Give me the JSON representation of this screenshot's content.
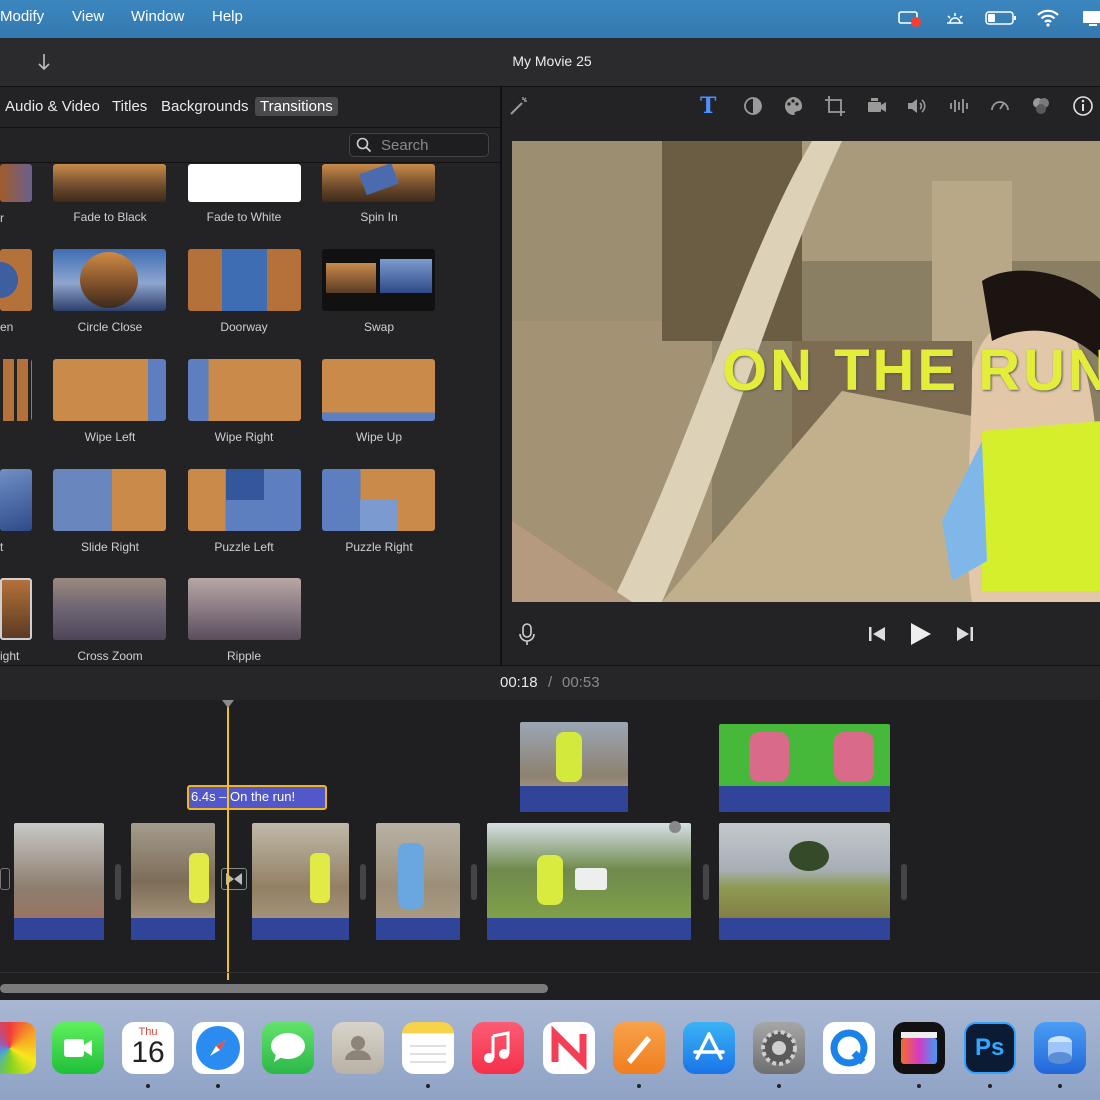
{
  "menubar": {
    "items": [
      "Modify",
      "View",
      "Window",
      "Help"
    ]
  },
  "window": {
    "title": "My Movie 25"
  },
  "browser": {
    "tabs": [
      "Audio & Video",
      "Titles",
      "Backgrounds",
      "Transitions"
    ],
    "active_tab": "Transitions",
    "search_placeholder": "Search",
    "partial_labels": [
      "r",
      "en",
      "t",
      "ight"
    ],
    "transitions": [
      {
        "label": "Fade to Black"
      },
      {
        "label": "Fade to White"
      },
      {
        "label": "Spin In"
      },
      {
        "label": "Circle Close"
      },
      {
        "label": "Doorway"
      },
      {
        "label": "Swap"
      },
      {
        "label": "Wipe Left"
      },
      {
        "label": "Wipe Right"
      },
      {
        "label": "Wipe Up"
      },
      {
        "label": "Slide Right"
      },
      {
        "label": "Puzzle Left"
      },
      {
        "label": "Puzzle Right"
      },
      {
        "label": "Cross Zoom"
      },
      {
        "label": "Ripple"
      }
    ]
  },
  "viewer": {
    "overlay_title": "ON THE RUN"
  },
  "timeline": {
    "current_time": "00:18",
    "separator": "/",
    "total_time": "00:53",
    "title_clip_label": "6.4s – On the run!"
  },
  "dock": {
    "calendar_day": "Thu",
    "calendar_date": "16",
    "apps": [
      "photos",
      "facetime",
      "calendar",
      "safari",
      "messages",
      "contacts",
      "notes",
      "music",
      "news",
      "pages",
      "app-store",
      "system-settings",
      "quicktime",
      "final-cut-pro",
      "photoshop",
      "preview"
    ]
  },
  "colors": {
    "menubar": "#3479b0",
    "accent": "#4e90ff",
    "title_clip": "#5257c9",
    "title_clip_border": "#f0b429",
    "playhead": "#f0c419",
    "overlay_text": "#e4ee3a"
  }
}
